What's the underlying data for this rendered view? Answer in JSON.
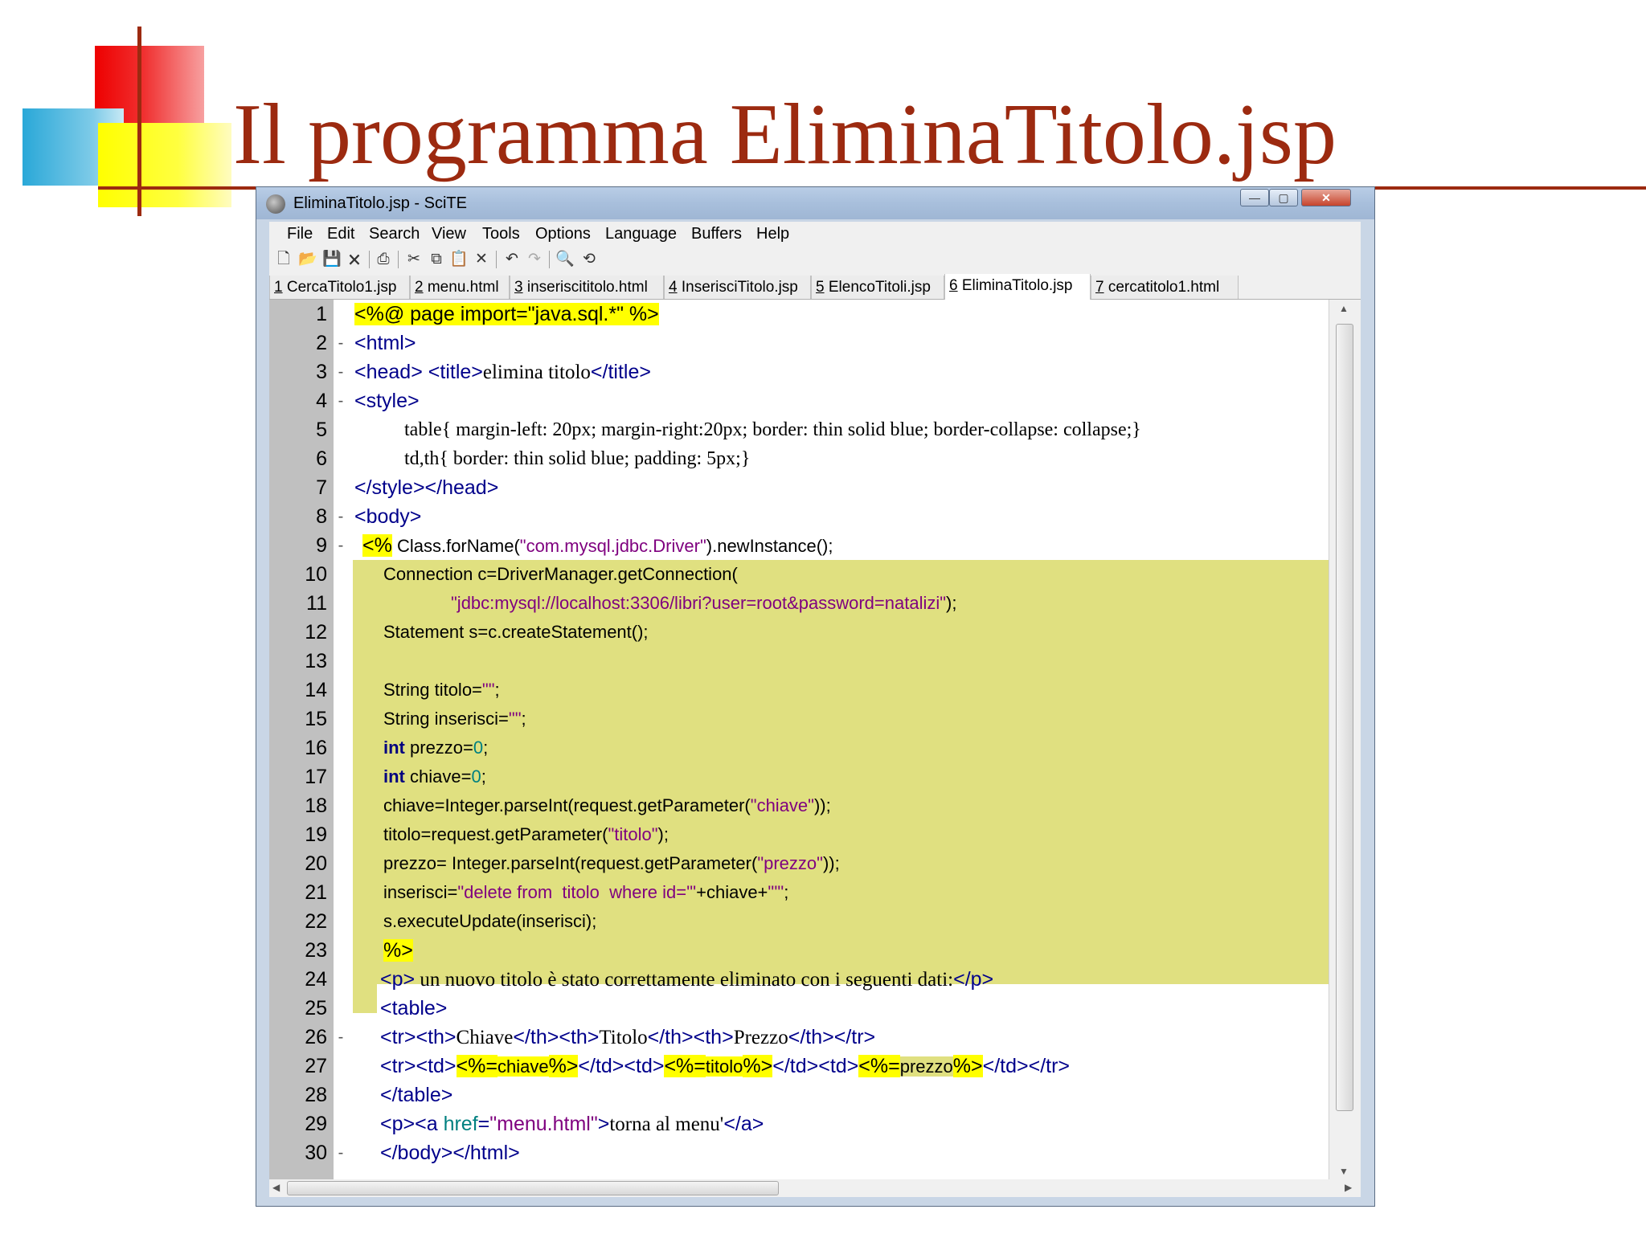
{
  "slide": {
    "title": "Il programma EliminaTitolo.jsp"
  },
  "window": {
    "title": "EliminaTitolo.jsp - SciTE",
    "buttons": {
      "minimize": "—",
      "maximize": "▢",
      "close": "✕"
    }
  },
  "menu": [
    "File",
    "Edit",
    "Search",
    "View",
    "Tools",
    "Options",
    "Language",
    "Buffers",
    "Help"
  ],
  "toolbar_icons": [
    "new-icon",
    "open-icon",
    "save-icon",
    "close-file-icon",
    "print-icon",
    "cut-icon",
    "copy-icon",
    "paste-icon",
    "delete-icon",
    "undo-icon",
    "redo-icon",
    "find-icon",
    "replace-icon"
  ],
  "tabs": [
    {
      "num": "1",
      "name": " CercaTitolo1.jsp",
      "active": false
    },
    {
      "num": "2",
      "name": " menu.html",
      "active": false
    },
    {
      "num": "3",
      "name": " inseriscititolo.html",
      "active": false
    },
    {
      "num": "4",
      "name": " InserisciTitolo.jsp",
      "active": false
    },
    {
      "num": "5",
      "name": " ElencoTitoli.jsp",
      "active": false
    },
    {
      "num": "6",
      "name": " EliminaTitolo.jsp",
      "active": true
    },
    {
      "num": "7",
      "name": " cercatitolo1.html",
      "active": false
    }
  ],
  "line_numbers": [
    "1",
    "2",
    "3",
    "4",
    "5",
    "6",
    "7",
    "8",
    "9",
    "10",
    "11",
    "12",
    "13",
    "14",
    "15",
    "16",
    "17",
    "18",
    "19",
    "20",
    "21",
    "22",
    "23",
    "24",
    "25",
    "26",
    "27",
    "28",
    "29",
    "30"
  ],
  "code": {
    "l1": [
      "<%@ page import=\"java.sql.*\" %>"
    ],
    "l2": [
      "<html>"
    ],
    "l3": [
      "<head>",
      " ",
      "<title>",
      "elimina titolo",
      "</title>"
    ],
    "l4": [
      "<style>"
    ],
    "l5": [
      "table{ margin-left: 20px; margin-right:20px; border: thin solid blue; border-collapse: collapse;}"
    ],
    "l6": [
      "td,th{ border: thin solid blue; padding: 5px;}"
    ],
    "l7": [
      "</style></head>"
    ],
    "l8": [
      "<body>"
    ],
    "l9": [
      "<%",
      " Class.forName(",
      "\"com.mysql.jdbc.Driver\"",
      ").newInstance();"
    ],
    "l10": [
      "Connection c=DriverManager.getConnection("
    ],
    "l11": [
      "\"jdbc:mysql://localhost:3306/libri?user=root&password=natalizi\"",
      ");"
    ],
    "l12": [
      "Statement s=c.createStatement();"
    ],
    "l14": [
      "String titolo=",
      "\"\"",
      ";"
    ],
    "l15": [
      "String inserisci=",
      "\"\"",
      ";"
    ],
    "l16": [
      "int",
      " prezzo=",
      "0",
      ";"
    ],
    "l17": [
      "int",
      " chiave=",
      "0",
      ";"
    ],
    "l18": [
      "chiave=Integer.parseInt(request.getParameter(",
      "\"chiave\"",
      "));"
    ],
    "l19": [
      "titolo=request.getParameter(",
      "\"titolo\"",
      ");"
    ],
    "l20": [
      "prezzo= Integer.parseInt(request.getParameter(",
      "\"prezzo\"",
      "));"
    ],
    "l21": [
      "inserisci=",
      "\"delete from  titolo  where id='\"",
      "+chiave+",
      "\"'\"",
      ";"
    ],
    "l22": [
      "s.executeUpdate(inserisci);"
    ],
    "l23": [
      "%>"
    ],
    "l24": [
      "<p>",
      " un nuovo titolo è stato correttamente eliminato con i seguenti dati:",
      "</p>"
    ],
    "l25": [
      "<table>"
    ],
    "l26": [
      "<tr><th>",
      "Chiave",
      "</th><th>",
      "Titolo",
      "</th><th>",
      "Prezzo",
      "</th></tr>"
    ],
    "l27": [
      "<tr><td>",
      "<%=",
      "chiave",
      "%>",
      "</td><td>",
      "<%=",
      "titolo",
      "%>",
      "</td><td>",
      "<%=",
      "prezzo",
      "%>",
      "</td></tr>"
    ],
    "l28": [
      "</table>"
    ],
    "l29": [
      "<p><a ",
      "href",
      "=",
      "\"menu.html\"",
      ">",
      "torna al menu'",
      "</a>"
    ],
    "l30": [
      "</body></html>"
    ]
  },
  "colors": {
    "title": "#9c2a10",
    "tag": "#00008b",
    "string": "#7f007f",
    "number": "#008080",
    "jsp_block": "#e0e080",
    "highlight": "#ffff00"
  }
}
